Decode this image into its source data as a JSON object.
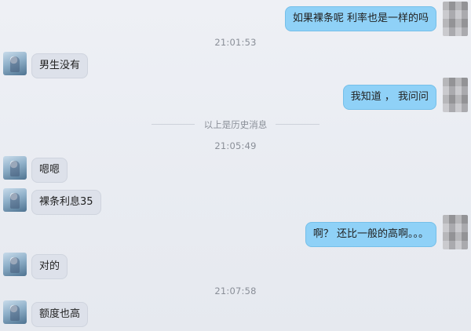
{
  "messages": [
    {
      "side": "self",
      "text": "如果裸条呢 利率也是一样的吗"
    },
    {
      "side": "contact",
      "text": "男生没有"
    },
    {
      "side": "self",
      "text": "我知道 ， 我问问"
    },
    {
      "side": "contact",
      "text": "嗯嗯"
    },
    {
      "side": "contact",
      "text": "裸条利息35"
    },
    {
      "side": "self",
      "text": "啊？ 还比一般的高啊。。。"
    },
    {
      "side": "contact",
      "text": "对的"
    },
    {
      "side": "contact",
      "text": "额度也高"
    }
  ],
  "timestamps": [
    "21:01:53",
    "21:05:49",
    "21:07:58"
  ],
  "history_divider": "以上是历史消息",
  "colors": {
    "outgoing_bubble": "#8fd1f7",
    "incoming_bubble": "#dde1ea",
    "timestamp_text": "#8a8f98"
  },
  "icons": {
    "self_avatar": "pixelated-avatar-icon",
    "contact_avatar": "user-avatar-icon"
  }
}
